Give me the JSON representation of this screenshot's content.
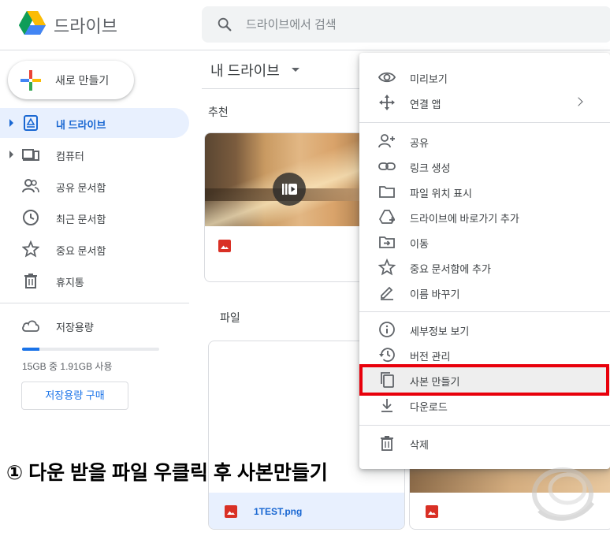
{
  "header": {
    "app_title": "드라이브",
    "search_placeholder": "드라이브에서 검색"
  },
  "sidebar": {
    "new_button_label": "새로 만들기",
    "items": [
      {
        "label": "내 드라이브",
        "icon": "my-drive-icon",
        "active": true,
        "expandable": true
      },
      {
        "label": "컴퓨터",
        "icon": "computers-icon",
        "active": false,
        "expandable": true
      },
      {
        "label": "공유 문서함",
        "icon": "shared-icon",
        "active": false
      },
      {
        "label": "최근 문서함",
        "icon": "clock-icon",
        "active": false
      },
      {
        "label": "중요 문서함",
        "icon": "star-icon",
        "active": false
      },
      {
        "label": "휴지통",
        "icon": "trash-icon",
        "active": false
      }
    ],
    "storage": {
      "label": "저장용량",
      "usage_text": "15GB 중 1.91GB 사용",
      "used_fraction": 0.127,
      "buy_button_label": "저장용량 구매"
    }
  },
  "main": {
    "title": "내 드라이브",
    "suggested_label": "추천",
    "files_label": "파일",
    "files": [
      {
        "name": "1TEST.png"
      }
    ]
  },
  "context_menu": {
    "groups": [
      [
        {
          "label": "미리보기",
          "icon": "eye-icon"
        },
        {
          "label": "연결 앱",
          "icon": "open-with-icon",
          "submenu": true
        }
      ],
      [
        {
          "label": "공유",
          "icon": "person-add-icon"
        },
        {
          "label": "링크 생성",
          "icon": "link-icon"
        },
        {
          "label": "파일 위치 표시",
          "icon": "folder-icon"
        },
        {
          "label": "드라이브에 바로가기 추가",
          "icon": "drive-shortcut-icon"
        },
        {
          "label": "이동",
          "icon": "move-icon"
        },
        {
          "label": "중요 문서함에 추가",
          "icon": "star-icon"
        },
        {
          "label": "이름 바꾸기",
          "icon": "pencil-icon"
        }
      ],
      [
        {
          "label": "세부정보 보기",
          "icon": "info-icon"
        },
        {
          "label": "버전 관리",
          "icon": "history-icon"
        },
        {
          "label": "사본 만들기",
          "icon": "copy-icon",
          "highlighted": true
        },
        {
          "label": "다운로드",
          "icon": "download-icon"
        }
      ],
      [
        {
          "label": "삭제",
          "icon": "trash-icon"
        }
      ]
    ]
  },
  "annotation": {
    "text": "① 다운 받을 파일 우클릭 후 사본만들기",
    "highlight_color": "#e8000b"
  },
  "colors": {
    "accent": "#1a73e8",
    "active_bg": "#e8f0fe",
    "active_text": "#1967d2"
  }
}
